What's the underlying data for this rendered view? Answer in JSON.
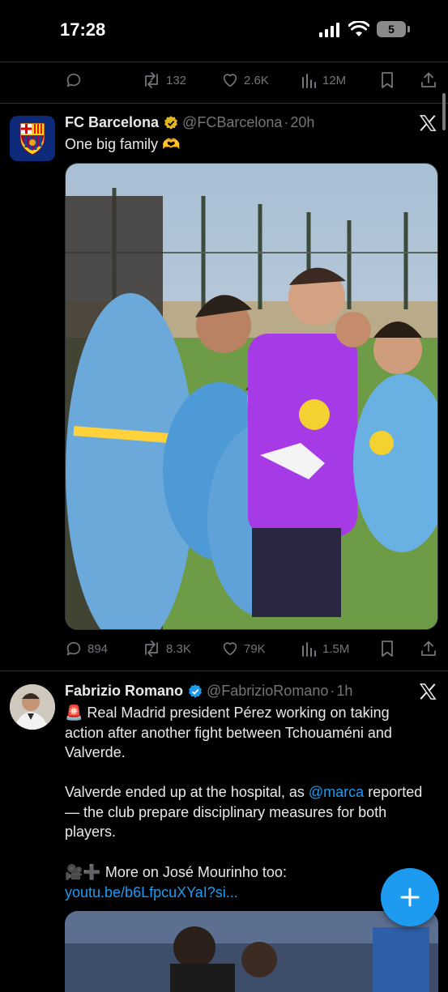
{
  "status_bar": {
    "time": "17:28",
    "battery": "5"
  },
  "prev_tweet": {
    "replies": "",
    "retweets": "132",
    "likes": "2.6K",
    "views": "12M"
  },
  "tweet1": {
    "name": "FC Barcelona",
    "handle": "@FCBarcelona",
    "separator": "·",
    "time": "20h",
    "text": "One big family 🫶",
    "replies": "894",
    "retweets": "8.3K",
    "likes": "79K",
    "views": "1.5M"
  },
  "tweet2": {
    "name": "Fabrizio Romano",
    "handle": "@FabrizioRomano",
    "separator": "·",
    "time": "1h",
    "line1": "🚨 Real Madrid president Pérez working on taking action after another fight between Tchouaméni and Valverde.",
    "line2_pre": "Valverde ended up at the hospital, as ",
    "line2_link": "@marca",
    "line2_post": " reported — the club prepare disciplinary measures for both players.",
    "line3_pre": "🎥➕ More on José Mourinho too: ",
    "line3_link": "youtu.be/b6LfpcuXYaI?si..."
  },
  "icons": {
    "accent": "#1d9bf0",
    "muted": "#71767b",
    "verified_gold": "#e2b719"
  }
}
